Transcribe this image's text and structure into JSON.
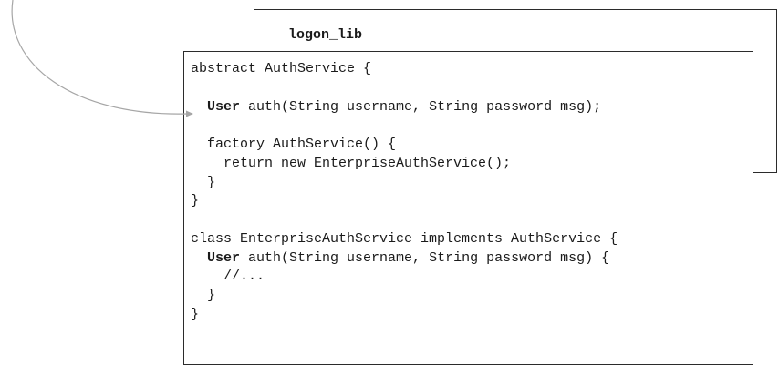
{
  "library": {
    "name": "logon_lib"
  },
  "code_lines": [
    [
      {
        "t": "abstract AuthService {"
      }
    ],
    [
      {
        "t": ""
      }
    ],
    [
      {
        "t": "  "
      },
      {
        "t": "User",
        "b": true
      },
      {
        "t": " auth(String username, String password msg);"
      }
    ],
    [
      {
        "t": ""
      }
    ],
    [
      {
        "t": "  factory AuthService() {"
      }
    ],
    [
      {
        "t": "    return new EnterpriseAuthService();"
      }
    ],
    [
      {
        "t": "  }"
      }
    ],
    [
      {
        "t": "}"
      }
    ],
    [
      {
        "t": ""
      }
    ],
    [
      {
        "t": "class EnterpriseAuthService implements AuthService {"
      }
    ],
    [
      {
        "t": "  "
      },
      {
        "t": "User",
        "b": true
      },
      {
        "t": " auth(String username, String password msg) {"
      }
    ],
    [
      {
        "t": "    //..."
      }
    ],
    [
      {
        "t": "  }"
      }
    ],
    [
      {
        "t": "}"
      }
    ]
  ],
  "colors": {
    "arrow": "#a6a6a6",
    "border": "#2b2b2b",
    "text": "#1a1a1a"
  }
}
